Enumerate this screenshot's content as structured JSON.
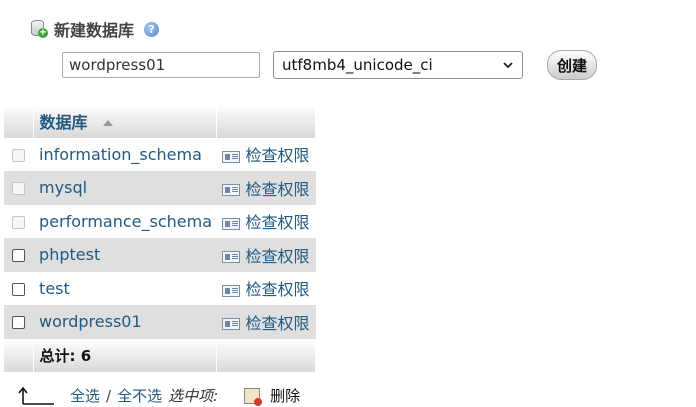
{
  "create": {
    "title": "新建数据库",
    "help_icon": "help-icon",
    "db_name_value": "wordpress01",
    "collation_selected": "utf8mb4_unicode_ci",
    "button_label": "创建"
  },
  "table": {
    "header": {
      "database_label": "数据库",
      "sort_indicator": "ascending"
    },
    "rows": [
      {
        "name": "information_schema",
        "privileges_label": "检查权限",
        "checkbox_enabled": false
      },
      {
        "name": "mysql",
        "privileges_label": "检查权限",
        "checkbox_enabled": false
      },
      {
        "name": "performance_schema",
        "privileges_label": "检查权限",
        "checkbox_enabled": false
      },
      {
        "name": "phptest",
        "privileges_label": "检查权限",
        "checkbox_enabled": true
      },
      {
        "name": "test",
        "privileges_label": "检查权限",
        "checkbox_enabled": true
      },
      {
        "name": "wordpress01",
        "privileges_label": "检查权限",
        "checkbox_enabled": true
      }
    ],
    "total_label": "总计: 6"
  },
  "actions": {
    "select_all": "全选",
    "separator": "/",
    "deselect_all": "全不选",
    "selected_label": "选中项:",
    "drop_label": "删除"
  },
  "colors": {
    "link": "#235a81",
    "row_alt": "#dfdfdf"
  }
}
